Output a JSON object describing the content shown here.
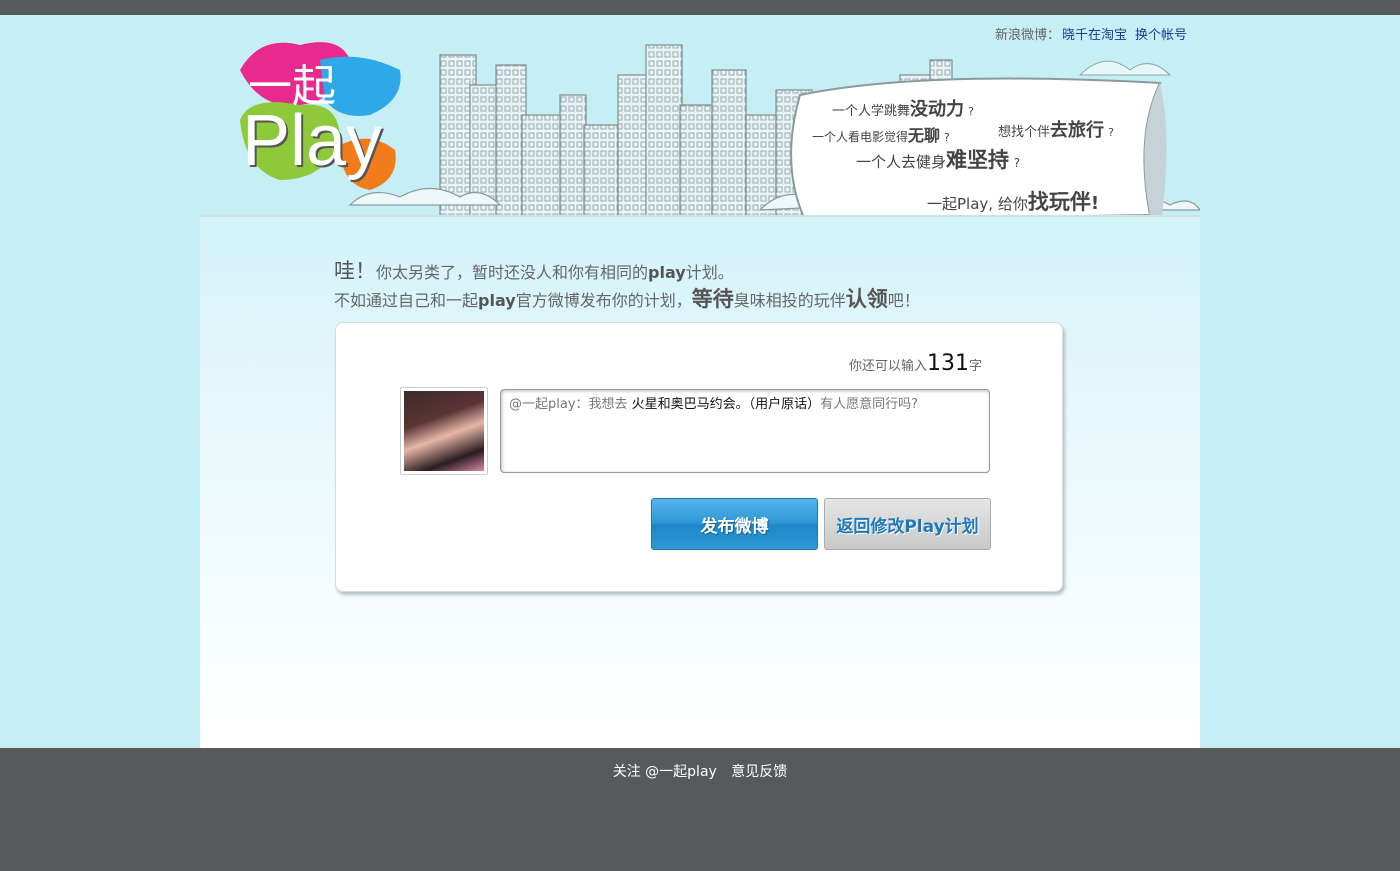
{
  "header": {
    "logo_text_cn": "一起",
    "logo_text_en": "Play",
    "account_prefix": "新浪微博：",
    "account_name": "晓千在淘宝",
    "switch_account": "换个帐号"
  },
  "banner_bubble": {
    "line1_a": "一个人学跳舞",
    "line1_b": "没动力",
    "line2_a": "一个人看电影觉得",
    "line2_b": "无聊",
    "line3_a": "想找个伴",
    "line3_b": "去旅行",
    "line4_a": "一个人去健身",
    "line4_b": "难坚持",
    "line5_a": "一起Play, 给你",
    "line5_b": "找玩伴",
    "q": "?",
    "excl": "!"
  },
  "message": {
    "wow": "哇！",
    "line1": "你太另类了，暂时还没人和你有相同的",
    "play": "play",
    "plan": "计划。",
    "line2_a": "不如通过自己和一起",
    "line2_b": "官方微博发布你的计划，",
    "wait": "等待",
    "line2_c": "臭味相投的玩伴",
    "claim": "认领",
    "line2_d": "吧！"
  },
  "composer": {
    "counter_prefix": "你还可以输入",
    "counter_value": "131",
    "counter_suffix": "字",
    "text_prefix": "@一起play：我想去 ",
    "text_plan": "火星和奥巴马约会。（用户原话）",
    "text_suffix": "有人愿意同行吗?",
    "post_button": "发布微博",
    "back_button": "返回修改Play计划"
  },
  "footer": {
    "follow": "关注 @一起play",
    "feedback": "意见反馈"
  }
}
